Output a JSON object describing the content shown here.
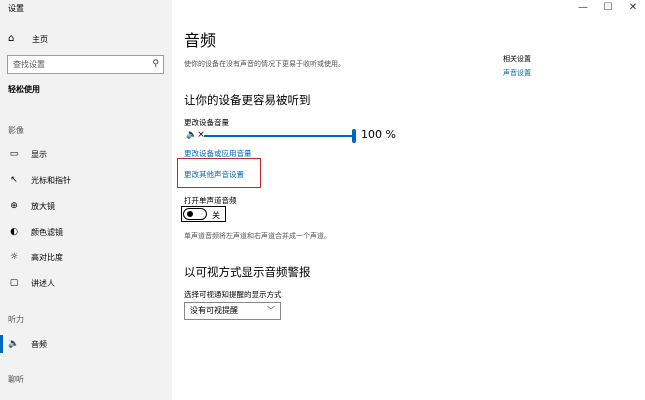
{
  "window": {
    "title": "设置",
    "minimize_glyph": "—",
    "maximize_glyph": "☐",
    "close_glyph": "✕"
  },
  "sidebar": {
    "home": {
      "label": "主页",
      "icon": "home-icon"
    },
    "search_placeholder": "查找设置",
    "category": "轻松使用",
    "sections": {
      "vision": "影像",
      "hearing": "听力",
      "interaction": "聊听"
    },
    "items": [
      {
        "label": "显示",
        "icon": "display-icon",
        "glyph": "▭"
      },
      {
        "label": "光标和指针",
        "icon": "cursor-icon",
        "glyph": "↖"
      },
      {
        "label": "放大镜",
        "icon": "magnifier-icon",
        "glyph": "⊕"
      },
      {
        "label": "颜色滤镜",
        "icon": "color-filter-icon",
        "glyph": "◐"
      },
      {
        "label": "高对比度",
        "icon": "contrast-icon",
        "glyph": "☼"
      },
      {
        "label": "讲述人",
        "icon": "narrator-icon",
        "glyph": "▢"
      },
      {
        "label": "音频",
        "icon": "audio-icon",
        "glyph": "🔈"
      }
    ],
    "active_item": "音频"
  },
  "main": {
    "title": "音频",
    "description": "使你的设备在没有声音的情况下更易于收听或使用。",
    "related": {
      "title": "相关设置",
      "link": "声音设置"
    },
    "section1": {
      "heading": "让你的设备更容易被听到",
      "volume_label": "更改设备音量",
      "volume_value": "100 %",
      "volume_level": 1.0,
      "link_app_volume": "更改设备或应用音量",
      "link_other_sound": "更改其他声音设置",
      "mono_label": "打开单声道音频",
      "mono_state": "关",
      "mono_note": "单声道音频将左声道和右声道合并成一个声道。"
    },
    "section2": {
      "heading": "以可视方式显示音频警报",
      "select_label": "选择可视通知提醒的显示方式",
      "select_value": "没有可视提醒"
    }
  },
  "colors": {
    "accent": "#0067c0",
    "highlight": "#c4262e",
    "sidebar_bg": "#f2f2f2"
  }
}
